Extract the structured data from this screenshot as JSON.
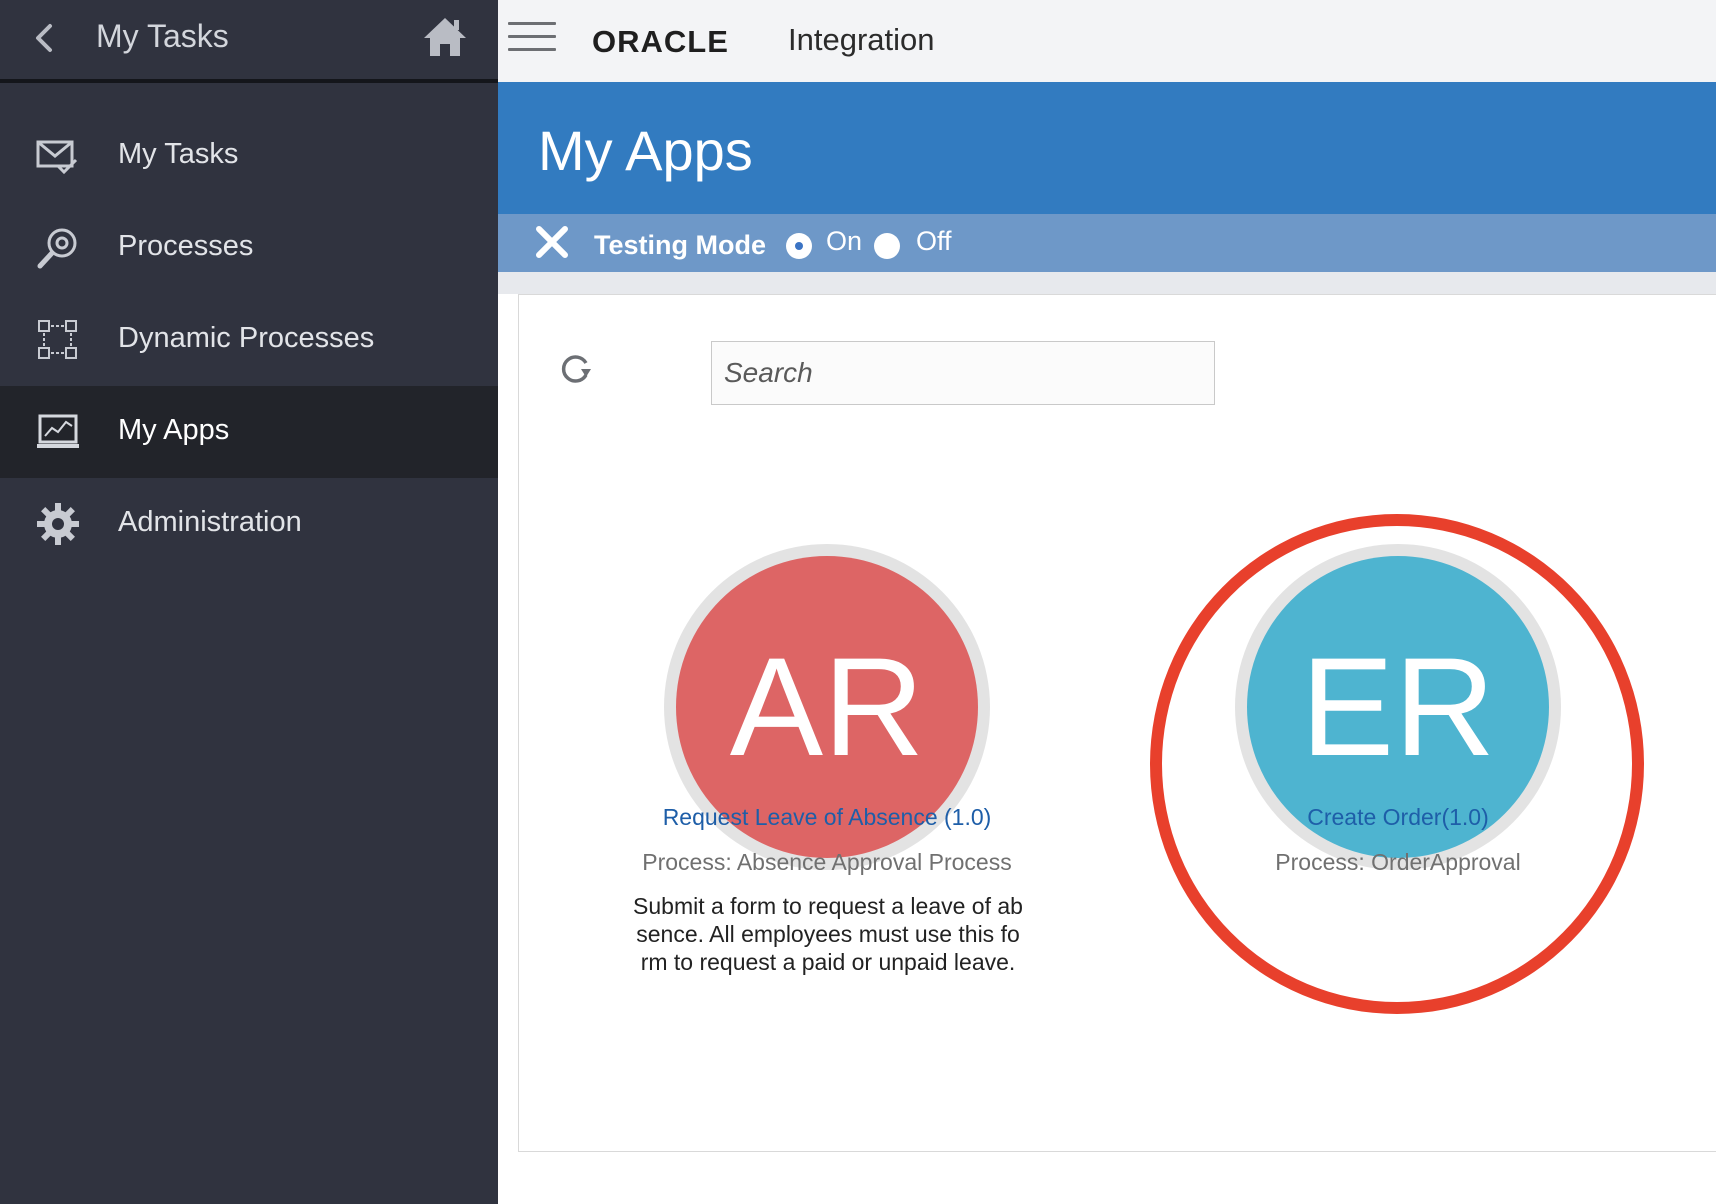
{
  "sidebar": {
    "title": "My Tasks",
    "items": [
      {
        "label": "My Tasks",
        "icon": "tasks-envelope-icon",
        "active": false
      },
      {
        "label": "Processes",
        "icon": "process-search-icon",
        "active": false
      },
      {
        "label": "Dynamic Processes",
        "icon": "dynamic-process-icon",
        "active": false
      },
      {
        "label": "My Apps",
        "icon": "monitor-chart-icon",
        "active": true
      },
      {
        "label": "Administration",
        "icon": "gear-icon",
        "active": false
      }
    ]
  },
  "topbar": {
    "logo": "ORACLE",
    "product": "Integration"
  },
  "banner": {
    "title": "My Apps"
  },
  "testing_mode": {
    "label": "Testing Mode",
    "on_label": "On",
    "off_label": "Off",
    "selected": "On"
  },
  "search": {
    "placeholder": "Search"
  },
  "apps": [
    {
      "initials": "AR",
      "name": "Request Leave of Absence (1.0)",
      "process": "Process: Absence Approval Process",
      "description": "Submit a form to request a leave of absence. All employees must use this form to request a paid or unpaid leave.",
      "color": "#dd6565"
    },
    {
      "initials": "ER",
      "name": "Create Order(1.0)",
      "process": "Process: OrderApproval",
      "description": "",
      "color": "#4eb4d0"
    }
  ],
  "colors": {
    "sidebar_bg": "#30333f",
    "active_item_bg": "#22242a",
    "banner_blue": "#327bc0",
    "testing_bar": "#6e98c8",
    "link_blue": "#1e5ea8",
    "highlight_red": "#e8402c"
  }
}
